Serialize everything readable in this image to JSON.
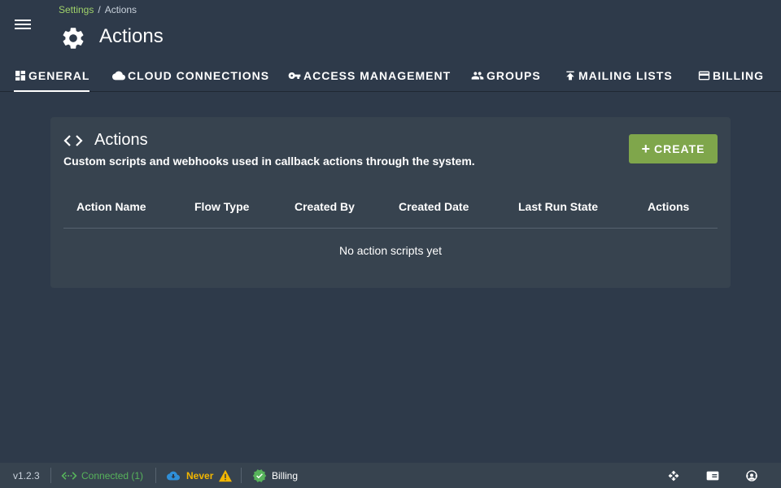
{
  "header": {
    "breadcrumb": {
      "parent": "Settings",
      "separator": "/",
      "current": "Actions"
    },
    "title": "Actions",
    "title_icon": "gear-icon",
    "menu_icon": "hamburger-menu-icon"
  },
  "tabs": [
    {
      "label": "GENERAL",
      "icon": "dashboard-icon",
      "active": true
    },
    {
      "label": "CLOUD CONNECTIONS",
      "icon": "cloud-icon",
      "active": false
    },
    {
      "label": "ACCESS MANAGEMENT",
      "icon": "key-icon",
      "active": false
    },
    {
      "label": "GROUPS",
      "icon": "people-icon",
      "active": false
    },
    {
      "label": "MAILING LISTS",
      "icon": "publish-icon",
      "active": false
    },
    {
      "label": "BILLING",
      "icon": "credit-card-icon",
      "active": false
    }
  ],
  "card": {
    "icon": "code-icon",
    "title": "Actions",
    "subtitle": "Custom scripts and webhooks used in callback actions through the system.",
    "create_label": "CREATE",
    "columns": [
      "Action Name",
      "Flow Type",
      "Created By",
      "Created Date",
      "Last Run State",
      "Actions"
    ],
    "empty_text": "No action scripts yet"
  },
  "footer": {
    "version": "v1.2.3",
    "connection": "Connected (1)",
    "sync": "Never",
    "billing": "Billing"
  },
  "colors": {
    "background": "#2e3a4a",
    "card": "#37434f",
    "accent_green": "#7fa64b",
    "breadcrumb_link": "#9fd16a",
    "connected": "#57b35b",
    "warning": "#f2b600",
    "sync_blue": "#2f8fd8"
  }
}
